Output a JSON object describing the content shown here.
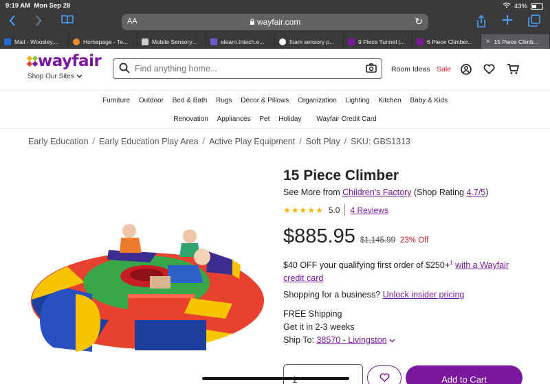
{
  "status": {
    "time": "9:19 AM",
    "date": "Mon Sep 28",
    "battery": "43%"
  },
  "browser": {
    "aa": "AA",
    "domain": "wayfair.com",
    "tabs": [
      {
        "label": "Mail - Woosley,...",
        "color": "#1e6fd9"
      },
      {
        "label": "Homepage - Te...",
        "color": "#e88a2e"
      },
      {
        "label": "Mobile Sensory...",
        "color": "#cfcfcf"
      },
      {
        "label": "elearn.tntech.e...",
        "color": "#6a5acd"
      },
      {
        "label": "foam sensory p...",
        "color": "#ffffff"
      },
      {
        "label": "9 Piece Tunnel |...",
        "color": "#7b189f"
      },
      {
        "label": "6 Piece Climber...",
        "color": "#7b189f"
      },
      {
        "label": "15 Piece Climb...",
        "color": "#999999"
      }
    ]
  },
  "header": {
    "logo": "wayfair",
    "shop_sites": "Shop Our Sites",
    "search_placeholder": "Find anything home...",
    "room_ideas": "Room Ideas",
    "sale": "Sale"
  },
  "nav": {
    "row1": [
      "Furniture",
      "Outdoor",
      "Bed & Bath",
      "Rugs",
      "Décor & Pillows",
      "Organization",
      "Lighting",
      "Kitchen",
      "Baby & Kids"
    ],
    "row2": [
      "Renovation",
      "Appliances",
      "Pet",
      "Holiday",
      "Wayfair Credit Card"
    ]
  },
  "breadcrumb": {
    "items": [
      "Early Education",
      "Early Education Play Area",
      "Active Play Equipment",
      "Soft Play"
    ],
    "sep": "/",
    "sku": "SKU: GBS1313"
  },
  "product": {
    "title": "15 Piece Climber",
    "see_more_prefix": "See More from",
    "brand": "Children's Factory",
    "shop_rating_prefix": "(Shop Rating",
    "shop_rating": "4.7/5",
    "shop_rating_suffix": ")",
    "stars": "★★★★★",
    "rating": "5.0",
    "rating_value": 5.0,
    "reviews": "4 Reviews",
    "price": "$885.95",
    "old_price": "$1,145.99",
    "pct_off": "23% Off",
    "offer_text": "$40 OFF your qualifying first order of $250+",
    "offer_sup": "1",
    "offer_link1": "with a Wayfair",
    "offer_link2": "credit card",
    "business_prefix": "Shopping for a business?",
    "business_link": "Unlock insider pricing",
    "free_shipping": "FREE Shipping",
    "delivery": "Get it in 2-3 weeks",
    "ship_to_label": "Ship To:",
    "ship_to": "38570 - Livingston",
    "qty": "1",
    "add_to_cart": "Add to Cart"
  },
  "colors": {
    "brand": "#7b189f",
    "sale": "#c81d25",
    "stars": "#f4b400"
  }
}
